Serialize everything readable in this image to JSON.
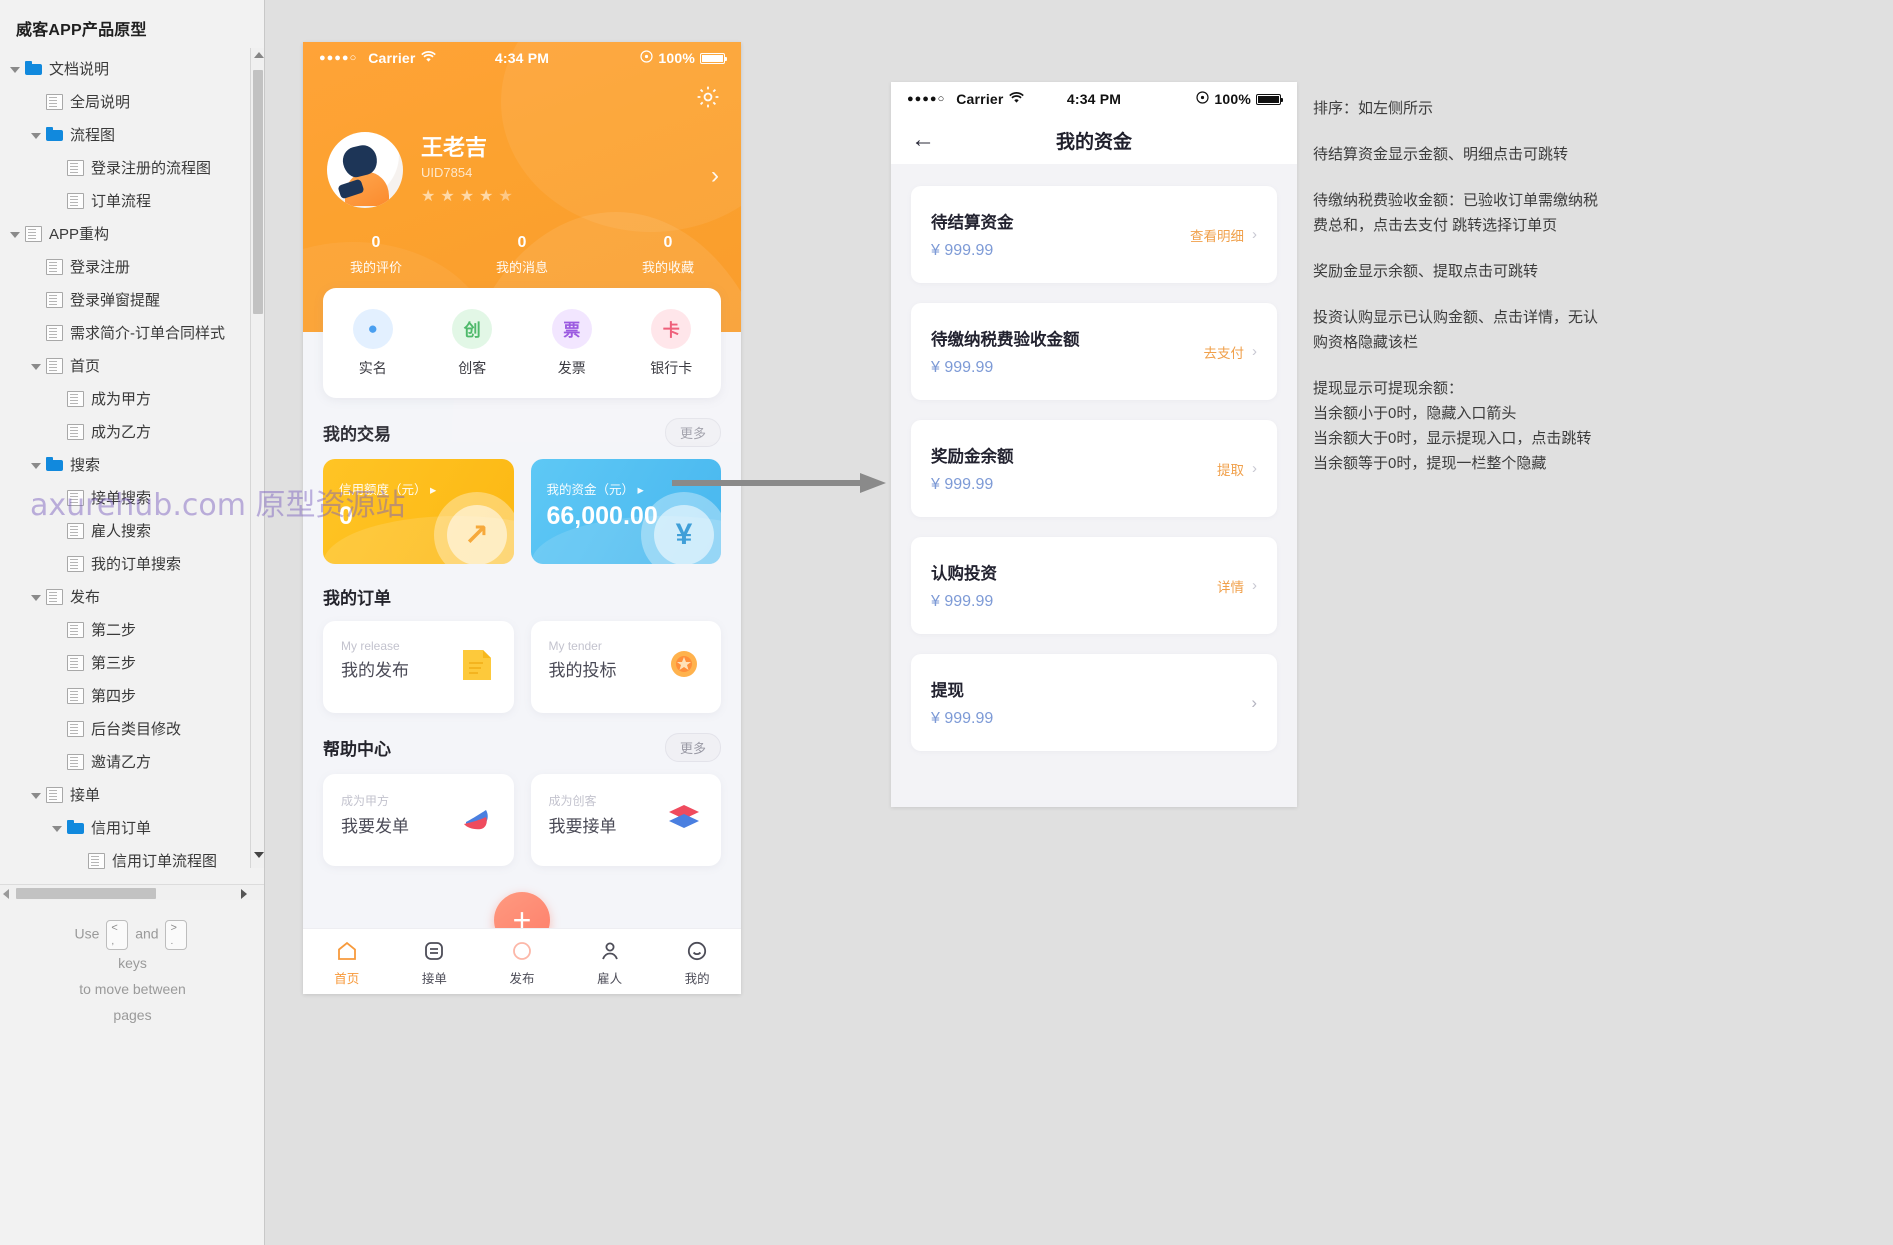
{
  "sidebar": {
    "title": "威客APP产品原型",
    "tree": [
      {
        "label": "文档说明",
        "depth": 0,
        "icon": "folder-icon",
        "arrow": true
      },
      {
        "label": "全局说明",
        "depth": 1,
        "icon": "page-icon",
        "arrow": false
      },
      {
        "label": "流程图",
        "depth": 1,
        "icon": "folder-icon",
        "arrow": true
      },
      {
        "label": "登录注册的流程图",
        "depth": 2,
        "icon": "page-icon",
        "arrow": false
      },
      {
        "label": "订单流程",
        "depth": 2,
        "icon": "page-icon",
        "arrow": false
      },
      {
        "label": "APP重构",
        "depth": 0,
        "icon": "page-icon",
        "arrow": true
      },
      {
        "label": "登录注册",
        "depth": 1,
        "icon": "page-icon",
        "arrow": false
      },
      {
        "label": "登录弹窗提醒",
        "depth": 1,
        "icon": "page-icon",
        "arrow": false
      },
      {
        "label": "需求简介-订单合同样式",
        "depth": 1,
        "icon": "page-icon",
        "arrow": false
      },
      {
        "label": "首页",
        "depth": 1,
        "icon": "page-icon",
        "arrow": true
      },
      {
        "label": "成为甲方",
        "depth": 2,
        "icon": "page-icon",
        "arrow": false
      },
      {
        "label": "成为乙方",
        "depth": 2,
        "icon": "page-icon",
        "arrow": false
      },
      {
        "label": "搜索",
        "depth": 1,
        "icon": "folder-icon",
        "arrow": true
      },
      {
        "label": "接单搜索",
        "depth": 2,
        "icon": "page-icon",
        "arrow": false
      },
      {
        "label": "雇人搜索",
        "depth": 2,
        "icon": "page-icon",
        "arrow": false
      },
      {
        "label": "我的订单搜索",
        "depth": 2,
        "icon": "page-icon",
        "arrow": false
      },
      {
        "label": "发布",
        "depth": 1,
        "icon": "page-icon",
        "arrow": true
      },
      {
        "label": "第二步",
        "depth": 2,
        "icon": "page-icon",
        "arrow": false
      },
      {
        "label": "第三步",
        "depth": 2,
        "icon": "page-icon",
        "arrow": false
      },
      {
        "label": "第四步",
        "depth": 2,
        "icon": "page-icon",
        "arrow": false
      },
      {
        "label": "后台类目修改",
        "depth": 2,
        "icon": "page-icon",
        "arrow": false
      },
      {
        "label": "邀请乙方",
        "depth": 2,
        "icon": "page-icon",
        "arrow": false
      },
      {
        "label": "接单",
        "depth": 1,
        "icon": "page-icon",
        "arrow": true
      },
      {
        "label": "信用订单",
        "depth": 2,
        "icon": "folder-icon",
        "arrow": true
      },
      {
        "label": "信用订单流程图",
        "depth": 3,
        "icon": "page-icon",
        "arrow": false
      }
    ],
    "hint": {
      "use": "Use",
      "key_prev": "<",
      "key_prev_sub": ",",
      "and": "and",
      "key_next": ">",
      "key_next_sub": ".",
      "keys": "keys",
      "line2": "to move between",
      "line3": "pages"
    }
  },
  "watermark": "axurehub.com 原型资源站",
  "phone1": {
    "status": {
      "dots": "●●●●○",
      "carrier": "Carrier",
      "time": "4:34 PM",
      "battery": "100%"
    },
    "profile": {
      "name": "王老吉",
      "uid": "UID7854",
      "stars_filled": 4,
      "stars_total": 5
    },
    "stats": [
      {
        "num": "0",
        "label": "我的评价"
      },
      {
        "num": "0",
        "label": "我的消息"
      },
      {
        "num": "0",
        "label": "我的收藏"
      }
    ],
    "quick": [
      {
        "label": "实名",
        "glyph": "●",
        "color": "#4a9ff0",
        "bg": "#e3f0ff"
      },
      {
        "label": "创客",
        "glyph": "创",
        "color": "#4fb96b",
        "bg": "#e2f7e6"
      },
      {
        "label": "发票",
        "glyph": "票",
        "color": "#9b5ae0",
        "bg": "#f2e6ff"
      },
      {
        "label": "银行卡",
        "glyph": "卡",
        "color": "#ef5f7a",
        "bg": "#ffe6ea"
      }
    ],
    "trade": {
      "heading": "我的交易",
      "more": "更多",
      "cards": [
        {
          "label": "信用额度（元）",
          "value": "0",
          "theme": "yellow",
          "symbol": "↗"
        },
        {
          "label": "我的资金（元）",
          "value": "66,000.00",
          "theme": "blue",
          "symbol": "¥"
        }
      ]
    },
    "orders": {
      "heading": "我的订单",
      "cards": [
        {
          "en": "My release",
          "cn": "我的发布"
        },
        {
          "en": "My tender",
          "cn": "我的投标"
        }
      ]
    },
    "help": {
      "heading": "帮助中心",
      "more": "更多",
      "cards": [
        {
          "en": "成为甲方",
          "cn": "我要发单"
        },
        {
          "en": "成为创客",
          "cn": "我要接单"
        }
      ]
    },
    "tabbar": [
      {
        "label": "首页",
        "icon": "home-icon",
        "active": true
      },
      {
        "label": "接单",
        "icon": "list-icon",
        "active": false
      },
      {
        "label": "发布",
        "icon": "plus-icon",
        "active": false
      },
      {
        "label": "雇人",
        "icon": "person-icon",
        "active": false
      },
      {
        "label": "我的",
        "icon": "smiley-icon",
        "active": false
      }
    ],
    "fab": "+"
  },
  "phone2": {
    "status": {
      "dots": "●●●●○",
      "carrier": "Carrier",
      "time": "4:34 PM",
      "battery": "100%"
    },
    "title": "我的资金",
    "back_icon": "back-arrow-icon",
    "items": [
      {
        "title": "待结算资金",
        "value": "¥ 999.99",
        "action": "查看明细",
        "has_action": true
      },
      {
        "title": "待缴纳税费验收金额",
        "value": "¥ 999.99",
        "action": "去支付",
        "has_action": true
      },
      {
        "title": "奖励金余额",
        "value": "¥ 999.99",
        "action": "提取",
        "has_action": true
      },
      {
        "title": "认购投资",
        "value": "¥ 999.99",
        "action": "详情",
        "has_action": true
      },
      {
        "title": "提现",
        "value": "¥ 999.99",
        "action": "",
        "has_action": false
      }
    ]
  },
  "annotations": [
    "排序：如左侧所示",
    "待结算资金显示金额、明细点击可跳转",
    "待缴纳税费验收金额：已验收订单需缴纳税\n费总和，点击去支付 跳转选择订单页",
    "奖励金显示余额、提取点击可跳转",
    "投资认购显示已认购金额、点击详情，无认\n购资格隐藏该栏",
    "提现显示可提现余额：\n当余额小于0时，隐藏入口箭头\n当余额大于0时，显示提现入口，点击跳转\n当余额等于0时，提现一栏整个隐藏"
  ],
  "colors": {
    "accent_orange": "#f79a3c",
    "header_orange": "#fca22f",
    "blue_card": "#4fb9ef",
    "yellow_card": "#fcb813",
    "value_blue": "#7d9ad6",
    "action_orange": "#f0a04b",
    "tree_folder": "#1189dd"
  }
}
